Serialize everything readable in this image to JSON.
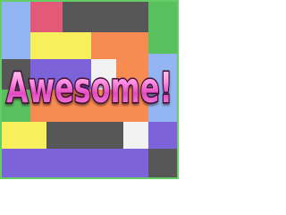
{
  "title": {
    "text": "Awesome!"
  },
  "colors": {
    "frame_green": "#66cc66",
    "text_fill_light": "#ffd6f2",
    "text_fill_dark": "#e04cc0",
    "text_stroke": "#3b0d33",
    "block_palette": {
      "sky": "#93b6f2",
      "rose": "#e25a77",
      "gray": "#575757",
      "green": "#58c15e",
      "yellow": "#f7ef5c",
      "orange": "#f78c52",
      "purple": "#7d63d9",
      "white": "#f2f2f2"
    }
  }
}
